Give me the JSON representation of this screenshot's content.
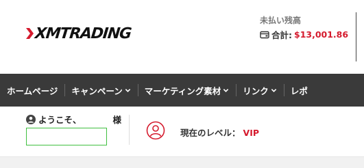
{
  "header": {
    "logo_text": "XMTRADING",
    "unpaid_label": "未払い残高",
    "total_label": "合計:",
    "total_amount": "$13,001.86",
    "icons": {
      "wallet": "wallet-icon"
    },
    "colors": {
      "amount": "#d51b2e"
    }
  },
  "nav": {
    "items": [
      {
        "label": "ホームページ",
        "dropdown": false
      },
      {
        "label": "キャンペーン",
        "dropdown": true
      },
      {
        "label": "マーケティング素材",
        "dropdown": true
      },
      {
        "label": "リンク",
        "dropdown": true
      },
      {
        "label": "レポ",
        "dropdown": false
      }
    ],
    "background": "#3a3a3a"
  },
  "user": {
    "welcome_text": "ようこそ、",
    "honorific": "様",
    "level_label": "現在のレベル：",
    "level_value": "VIP",
    "icons": {
      "user": "user-circle-icon",
      "level": "user-outline-icon"
    }
  }
}
